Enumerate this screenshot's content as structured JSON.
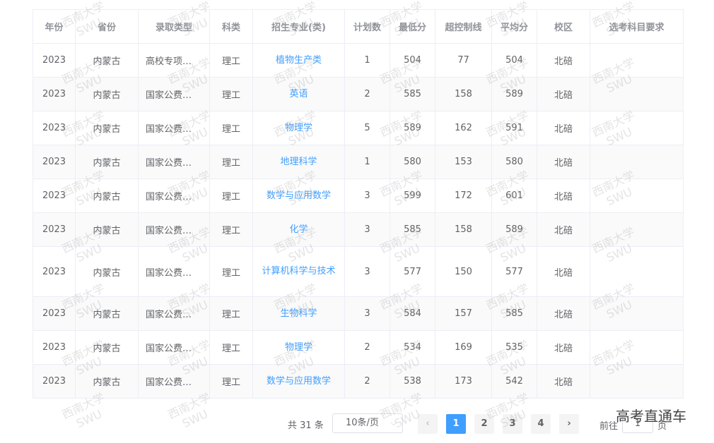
{
  "table": {
    "headers": [
      "年份",
      "省份",
      "录取类型",
      "科类",
      "招生专业(类)",
      "计划数",
      "最低分",
      "超控制线",
      "平均分",
      "校区",
      "选考科目要求"
    ],
    "rows": [
      [
        "2023",
        "内蒙古",
        "高校专项…",
        "理工",
        "植物生产类",
        "1",
        "504",
        "77",
        "504",
        "北碚",
        ""
      ],
      [
        "2023",
        "内蒙古",
        "国家公费…",
        "理工",
        "英语",
        "2",
        "585",
        "158",
        "589",
        "北碚",
        ""
      ],
      [
        "2023",
        "内蒙古",
        "国家公费…",
        "理工",
        "物理学",
        "5",
        "589",
        "162",
        "591",
        "北碚",
        ""
      ],
      [
        "2023",
        "内蒙古",
        "国家公费…",
        "理工",
        "地理科学",
        "1",
        "580",
        "153",
        "580",
        "北碚",
        ""
      ],
      [
        "2023",
        "内蒙古",
        "国家公费…",
        "理工",
        "数学与应用数学",
        "3",
        "599",
        "172",
        "601",
        "北碚",
        ""
      ],
      [
        "2023",
        "内蒙古",
        "国家公费…",
        "理工",
        "化学",
        "3",
        "585",
        "158",
        "589",
        "北碚",
        ""
      ],
      [
        "2023",
        "内蒙古",
        "国家公费…",
        "理工",
        "计算机科学与技术",
        "3",
        "577",
        "150",
        "577",
        "北碚",
        ""
      ],
      [
        "2023",
        "内蒙古",
        "国家公费…",
        "理工",
        "生物科学",
        "3",
        "584",
        "157",
        "585",
        "北碚",
        ""
      ],
      [
        "2023",
        "内蒙古",
        "国家公费…",
        "理工",
        "物理学",
        "2",
        "534",
        "169",
        "535",
        "北碚",
        ""
      ],
      [
        "2023",
        "内蒙古",
        "国家公费…",
        "理工",
        "数学与应用数学",
        "2",
        "538",
        "173",
        "542",
        "北碚",
        ""
      ]
    ]
  },
  "pager": {
    "total": "共 31 条",
    "page_size": "10条/页",
    "prev_icon": "chevron-left-icon",
    "next_icon": "chevron-right-icon",
    "pages": [
      "1",
      "2",
      "3",
      "4"
    ],
    "active_page": "1",
    "goto_prefix": "前往",
    "goto_value": "1",
    "goto_suffix": "页"
  },
  "watermark": {
    "line1": "西南大学",
    "line2": "SWU"
  },
  "brand_text": "高考直通车",
  "colors": {
    "accent": "#409eff",
    "border": "#ebeef5",
    "header_text": "#909399"
  }
}
